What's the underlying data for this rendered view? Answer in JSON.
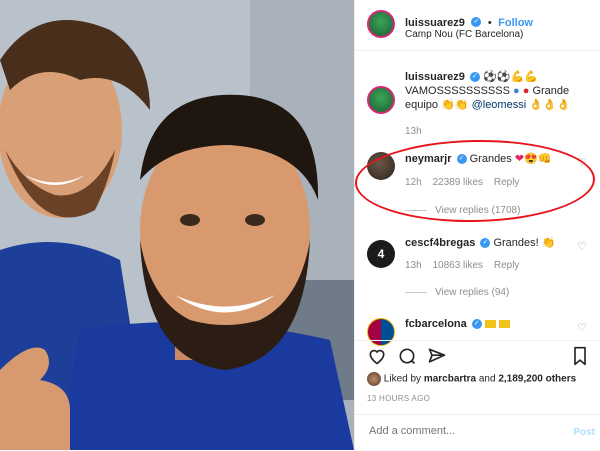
{
  "header": {
    "username": "luissuarez9",
    "separator": "•",
    "follow_label": "Follow",
    "location": "Camp Nou (FC Barcelona)"
  },
  "caption": {
    "username": "luissuarez9",
    "text_line1": "VAMOSSSSSSSSSS",
    "text_line2a": "Grande",
    "text_line2b": "equipo",
    "mention": "@leomessi",
    "time": "13h"
  },
  "comments": [
    {
      "username": "neymarjr",
      "text": "Grandes",
      "time": "12h",
      "likes": "22389 likes",
      "reply": "Reply",
      "view_replies": "View replies (1708)"
    },
    {
      "username": "cescf4bregas",
      "text": "Grandes!",
      "time": "13h",
      "likes": "10863 likes",
      "reply": "Reply",
      "view_replies": "View replies (94)"
    },
    {
      "username": "fcbarcelona",
      "text": ""
    }
  ],
  "likes_line": {
    "prefix": "Liked by",
    "user": "marcbartra",
    "and": "and",
    "count": "2,189,200 others"
  },
  "timestamp": "13 HOURS AGO",
  "add_comment": {
    "placeholder": "Add a comment...",
    "post_label": "Post"
  },
  "colors": {
    "accent": "#3897f0",
    "highlight": "#e8141b",
    "link": "#003569"
  }
}
